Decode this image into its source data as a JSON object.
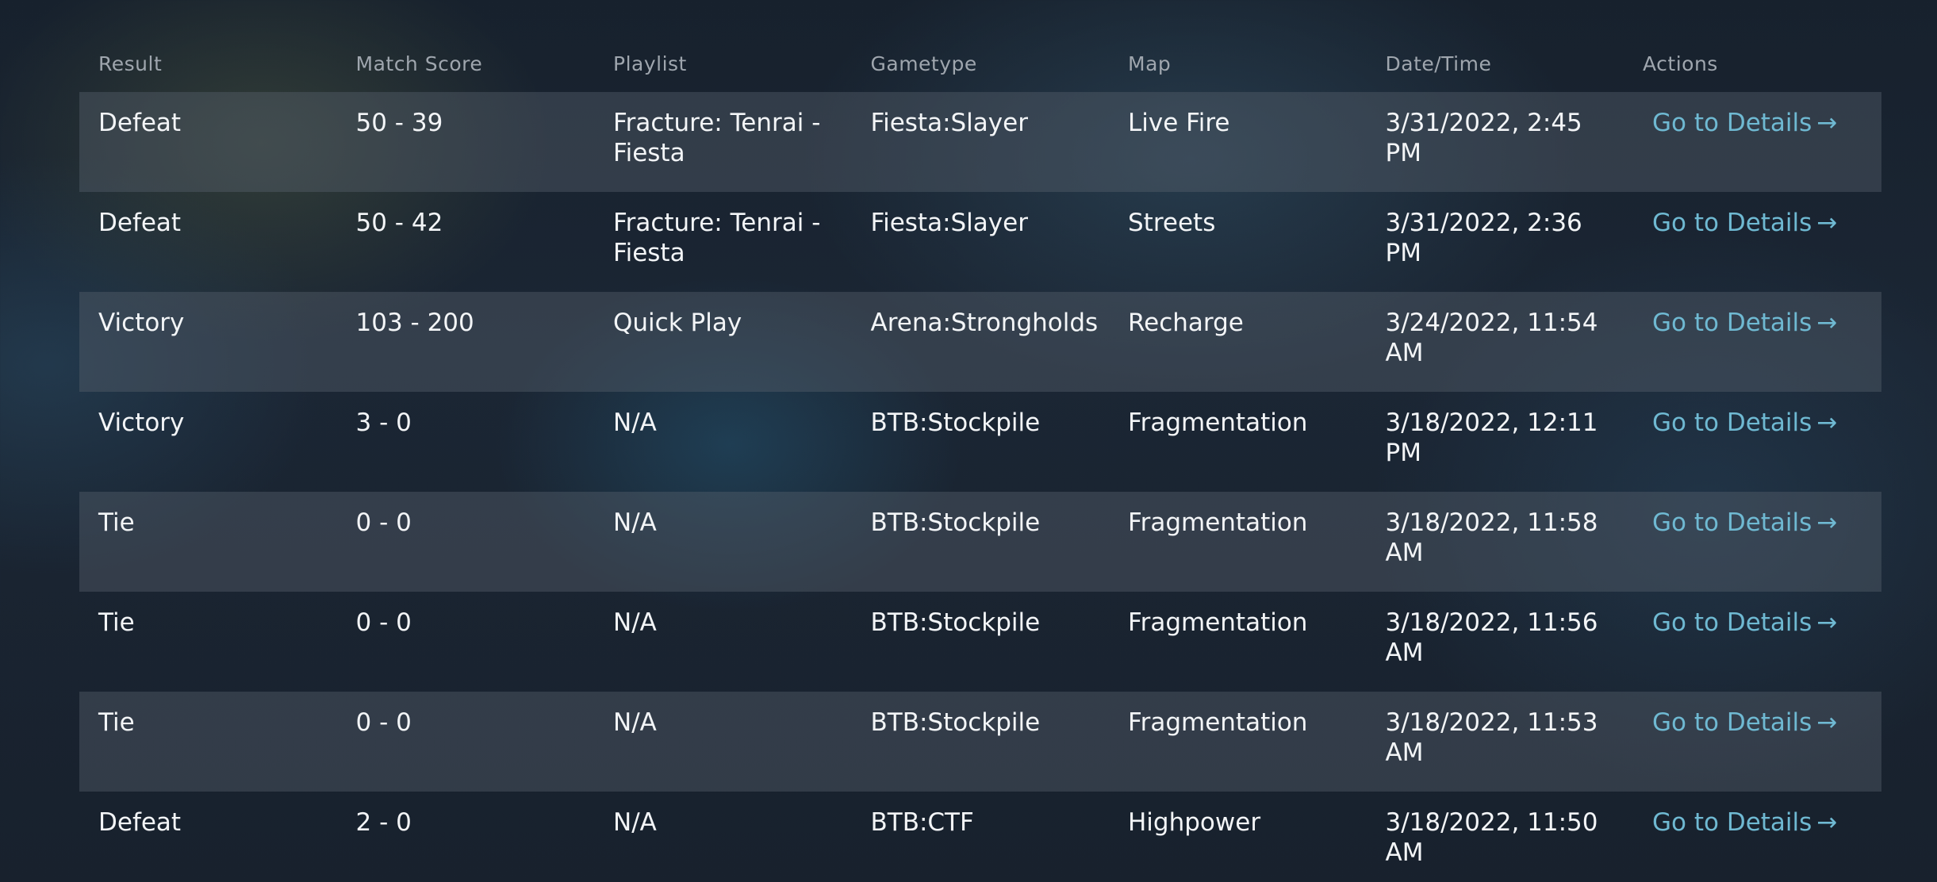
{
  "table": {
    "headers": {
      "result": "Result",
      "match_score": "Match Score",
      "playlist": "Playlist",
      "gametype": "Gametype",
      "map": "Map",
      "datetime": "Date/Time",
      "actions": "Actions"
    },
    "link_label": "Go to Details",
    "link_arrow": "→",
    "rows": [
      {
        "result": "Defeat",
        "score": "50 - 39",
        "playlist": "Fracture: Tenrai - Fiesta",
        "gametype": "Fiesta:Slayer",
        "map": "Live Fire",
        "datetime": "3/31/2022, 2:45 PM"
      },
      {
        "result": "Defeat",
        "score": "50 - 42",
        "playlist": "Fracture: Tenrai - Fiesta",
        "gametype": "Fiesta:Slayer",
        "map": "Streets",
        "datetime": "3/31/2022, 2:36 PM"
      },
      {
        "result": "Victory",
        "score": "103 - 200",
        "playlist": "Quick Play",
        "gametype": "Arena:Strongholds",
        "map": "Recharge",
        "datetime": "3/24/2022, 11:54 AM"
      },
      {
        "result": "Victory",
        "score": "3 - 0",
        "playlist": "N/A",
        "gametype": "BTB:Stockpile",
        "map": "Fragmentation",
        "datetime": "3/18/2022, 12:11 PM"
      },
      {
        "result": "Tie",
        "score": "0 - 0",
        "playlist": "N/A",
        "gametype": "BTB:Stockpile",
        "map": "Fragmentation",
        "datetime": "3/18/2022, 11:58 AM"
      },
      {
        "result": "Tie",
        "score": "0 - 0",
        "playlist": "N/A",
        "gametype": "BTB:Stockpile",
        "map": "Fragmentation",
        "datetime": "3/18/2022, 11:56 AM"
      },
      {
        "result": "Tie",
        "score": "0 - 0",
        "playlist": "N/A",
        "gametype": "BTB:Stockpile",
        "map": "Fragmentation",
        "datetime": "3/18/2022, 11:53 AM"
      },
      {
        "result": "Defeat",
        "score": "2 - 0",
        "playlist": "N/A",
        "gametype": "BTB:CTF",
        "map": "Highpower",
        "datetime": "3/18/2022, 11:50 AM"
      }
    ]
  },
  "colors": {
    "link": "#6fb9d2",
    "header_text": "#9fa6ae",
    "body_text": "#f3f5f7",
    "stripe": "rgba(88, 98, 110, 0.42)"
  }
}
